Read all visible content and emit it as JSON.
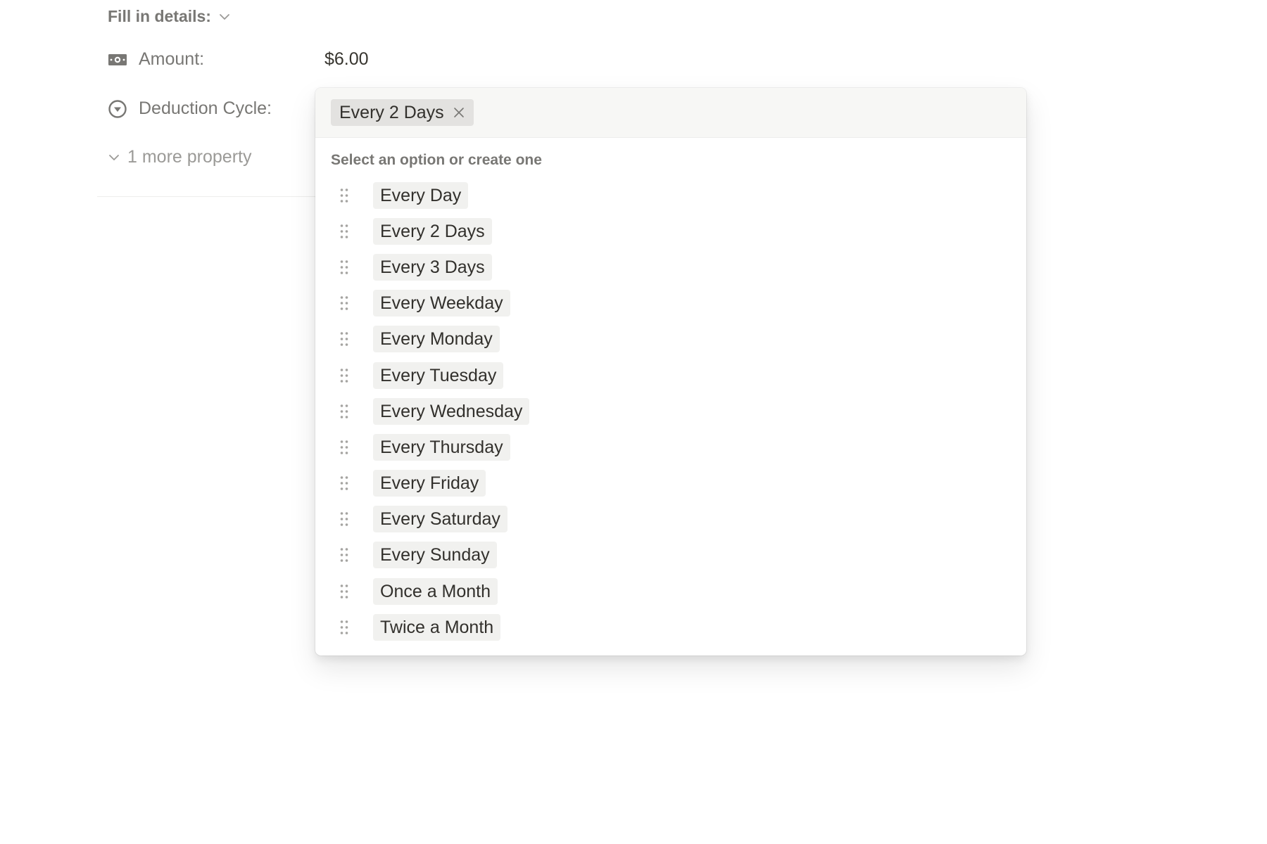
{
  "header": {
    "fill_in_details": "Fill in details:"
  },
  "properties": {
    "amount": {
      "label": "Amount:",
      "value": "$6.00",
      "icon": "money-icon"
    },
    "deduction_cycle": {
      "label": "Deduction Cycle:",
      "icon": "select-icon"
    },
    "more": "1 more property"
  },
  "dropdown": {
    "selected": "Every 2 Days",
    "hint": "Select an option or create one",
    "options": [
      "Every Day",
      "Every 2 Days",
      "Every 3 Days",
      "Every Weekday",
      "Every Monday",
      "Every Tuesday",
      "Every Wednesday",
      "Every Thursday",
      "Every Friday",
      "Every Saturday",
      "Every Sunday",
      "Once a Month",
      "Twice a Month"
    ]
  },
  "colors": {
    "muted_text": "#787774",
    "chip_bg": "#f1f1ef",
    "selected_chip_bg": "#e3e2e0",
    "input_bg": "#f7f7f5"
  }
}
